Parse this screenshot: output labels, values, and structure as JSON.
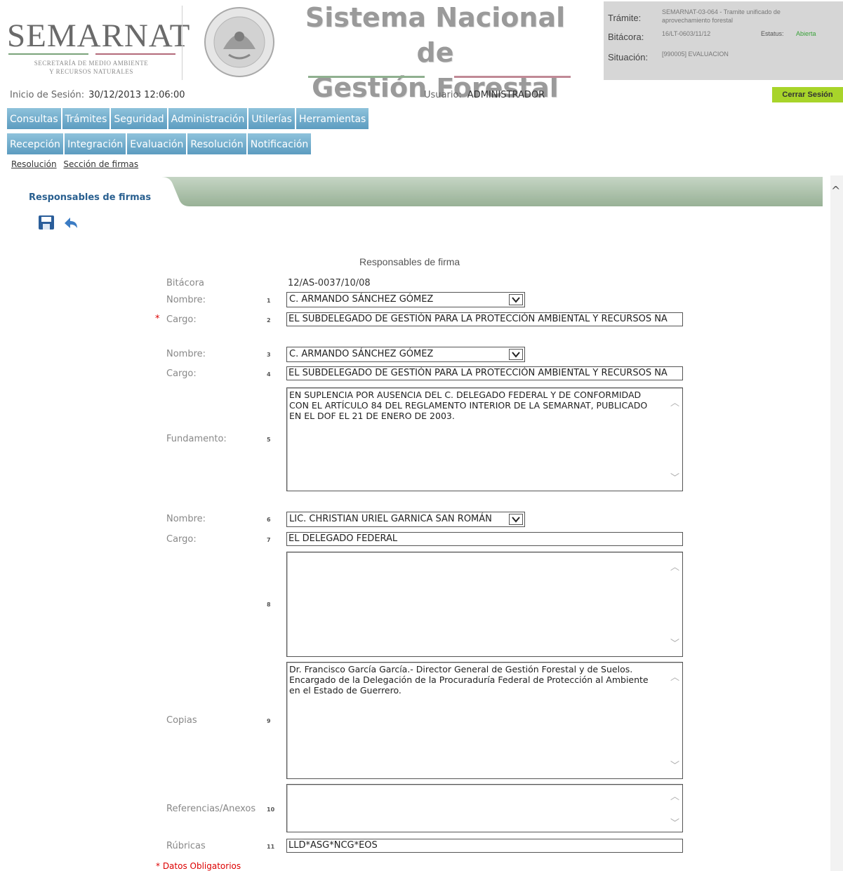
{
  "header": {
    "logo": "SEMARNAT",
    "logo_sub_line1": "SECRETARÍA DE MEDIO AMBIENTE",
    "logo_sub_line2": "Y RECURSOS NATURALES",
    "system_title_line1": "Sistema Nacional de",
    "system_title_line2": "Gestión Forestal"
  },
  "info": {
    "tramite_label": "Trámite:",
    "tramite_value_line1": "SEMARNAT-03-064 - Tramite unificado de",
    "tramite_value_line2": "aprovechamiento forestal",
    "bitacora_label": "Bitácora:",
    "bitacora_value": "16/LT-0603/11/12",
    "estatus_label": "Estatus:",
    "estatus_value": "Abierta",
    "situacion_label": "Situación:",
    "situacion_value": "[990005] EVALUACION"
  },
  "session": {
    "label": "Inicio de Sesión:",
    "value": "30/12/2013 12:06:00",
    "user_label": "Usuario:",
    "user_value": "ADMINISTRADOR",
    "logout": "Cerrar Sesión"
  },
  "menu1": [
    "Consultas",
    "Trámites",
    "Seguridad",
    "Administración",
    "Utilerías",
    "Herramientas"
  ],
  "menu2": [
    "Recepción",
    "Integración",
    "Evaluación",
    "Resolución",
    "Notificación"
  ],
  "breadcrumb": [
    "Resolución",
    "Sección de firmas"
  ],
  "tab": {
    "label": "Responsables de firmas"
  },
  "icons": {
    "save": "save-icon",
    "undo": "undo-icon"
  },
  "form": {
    "title": "Responsables de firma",
    "bitacora_label": "Bitácora",
    "bitacora_value": "12/AS-0037/10/08",
    "nombre_label": "Nombre:",
    "cargo_label": "Cargo:",
    "fundamento_label": "Fundamento:",
    "copias_label": "Copias",
    "referencias_label": "Referencias/Anexos",
    "rubricas_label": "Rúbricas",
    "required_mark": "*",
    "required_note": "* Datos Obligatorios",
    "nums": [
      "1",
      "2",
      "3",
      "4",
      "5",
      "6",
      "7",
      "8",
      "9",
      "10",
      "11"
    ],
    "nombre1": "C. ARMANDO SÁNCHEZ GÓMEZ",
    "cargo1": "EL SUBDELEGADO DE GESTIÓN PARA LA PROTECCIÓN AMBIENTAL Y RECURSOS NA",
    "nombre2": "C. ARMANDO SÁNCHEZ GÓMEZ",
    "cargo2": "EL SUBDELEGADO DE GESTIÓN PARA LA PROTECCIÓN AMBIENTAL Y RECURSOS NA",
    "fundamento": "EN SUPLENCIA POR AUSENCIA DEL C. DELEGADO FEDERAL Y DE CONFORMIDAD CON EL ARTÍCULO 84 DEL REGLAMENTO INTERIOR DE LA SEMARNAT, PUBLICADO EN EL DOF EL 21 DE ENERO DE 2003.",
    "nombre3": "LIC. CHRISTIAN URIEL GARNICA SAN ROMÁN",
    "cargo3": "EL DELEGADO FEDERAL",
    "campo8": "",
    "copias": "Dr. Francisco García García.- Director General de Gestión Forestal y de Suelos. Encargado de la Delegación de la Procuraduría Federal de Protección al Ambiente en el Estado de Guerrero.",
    "referencias": "",
    "rubricas": "LLD*ASG*NCG*EOS"
  }
}
